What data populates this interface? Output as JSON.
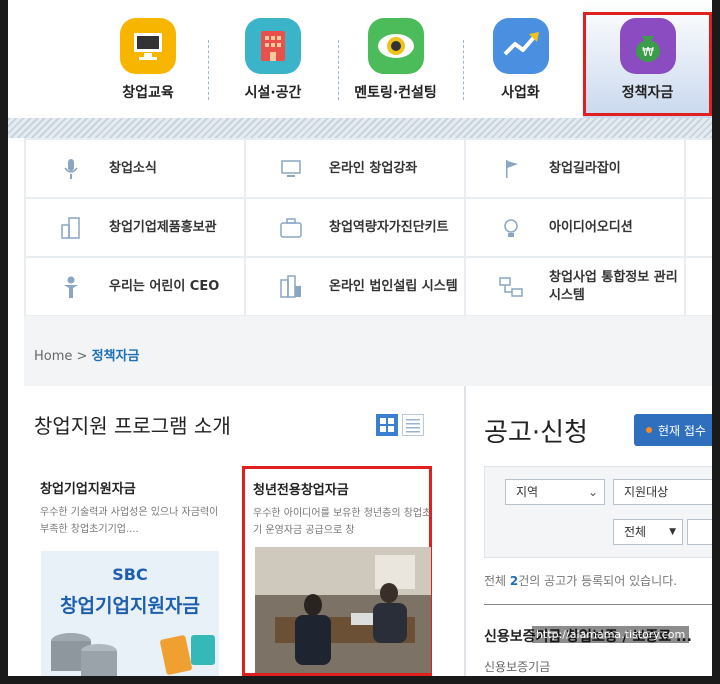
{
  "categories": [
    {
      "label": "창업교육",
      "icon": "monitor-icon",
      "color": "#f7b500"
    },
    {
      "label": "시설·공간",
      "icon": "building-icon",
      "color": "#3bb3c8"
    },
    {
      "label": "멘토링·컨설팅",
      "icon": "eye-icon",
      "color": "#4cbb5a"
    },
    {
      "label": "사업화",
      "icon": "growth-chart-icon",
      "color": "#4a8fe0"
    },
    {
      "label": "정책자금",
      "icon": "money-bag-icon",
      "color": "#8a4cc0"
    }
  ],
  "quick_menu": [
    {
      "label": "창업소식",
      "icon": "microphone-icon"
    },
    {
      "label": "온라인 창업강좌",
      "icon": "monitor-icon"
    },
    {
      "label": "창업길라잡이",
      "icon": "flag-icon"
    },
    {
      "label": "창업기업제품홍보관",
      "icon": "building-icon"
    },
    {
      "label": "창업역량자가진단키트",
      "icon": "toolkit-icon"
    },
    {
      "label": "아이디어오디션",
      "icon": "lightbulb-icon"
    },
    {
      "label": "우리는 어린이 CEO",
      "icon": "child-icon"
    },
    {
      "label": "온라인 법인설립 시스템",
      "icon": "city-icon"
    },
    {
      "label": "창업사업 통합정보 관리시스템",
      "icon": "network-icon"
    }
  ],
  "breadcrumb": {
    "home": "Home",
    "sep": ">",
    "current": "정책자금"
  },
  "programs": {
    "title": "창업지원 프로그램 소개",
    "cards": [
      {
        "title": "창업기업지원자금",
        "desc": "우수한 기술력과 사업성은 있으나 자금력이 부족한 창업초기기업....",
        "banner_brand": "SBC",
        "banner_title": "창업기업지원자금"
      },
      {
        "title": "청년전용창업자금",
        "desc": "우수한 아이디어를 보유한 청년층의 창업초기 운영자금 공급으로 창"
      }
    ]
  },
  "notices": {
    "title": "공고·신청",
    "button": "현재 접수",
    "filters": {
      "region": "지역",
      "target": "지원대상",
      "all": "전체"
    },
    "total_prefix": "전체 ",
    "total_count": "2",
    "total_suffix": "건의 공고가 등록되어 있습니다.",
    "item_title": "신용보증기금 창업보증 / 보증료 ...",
    "item_org": "신용보증기금"
  },
  "watermark": "http://alamama.tistory.com"
}
